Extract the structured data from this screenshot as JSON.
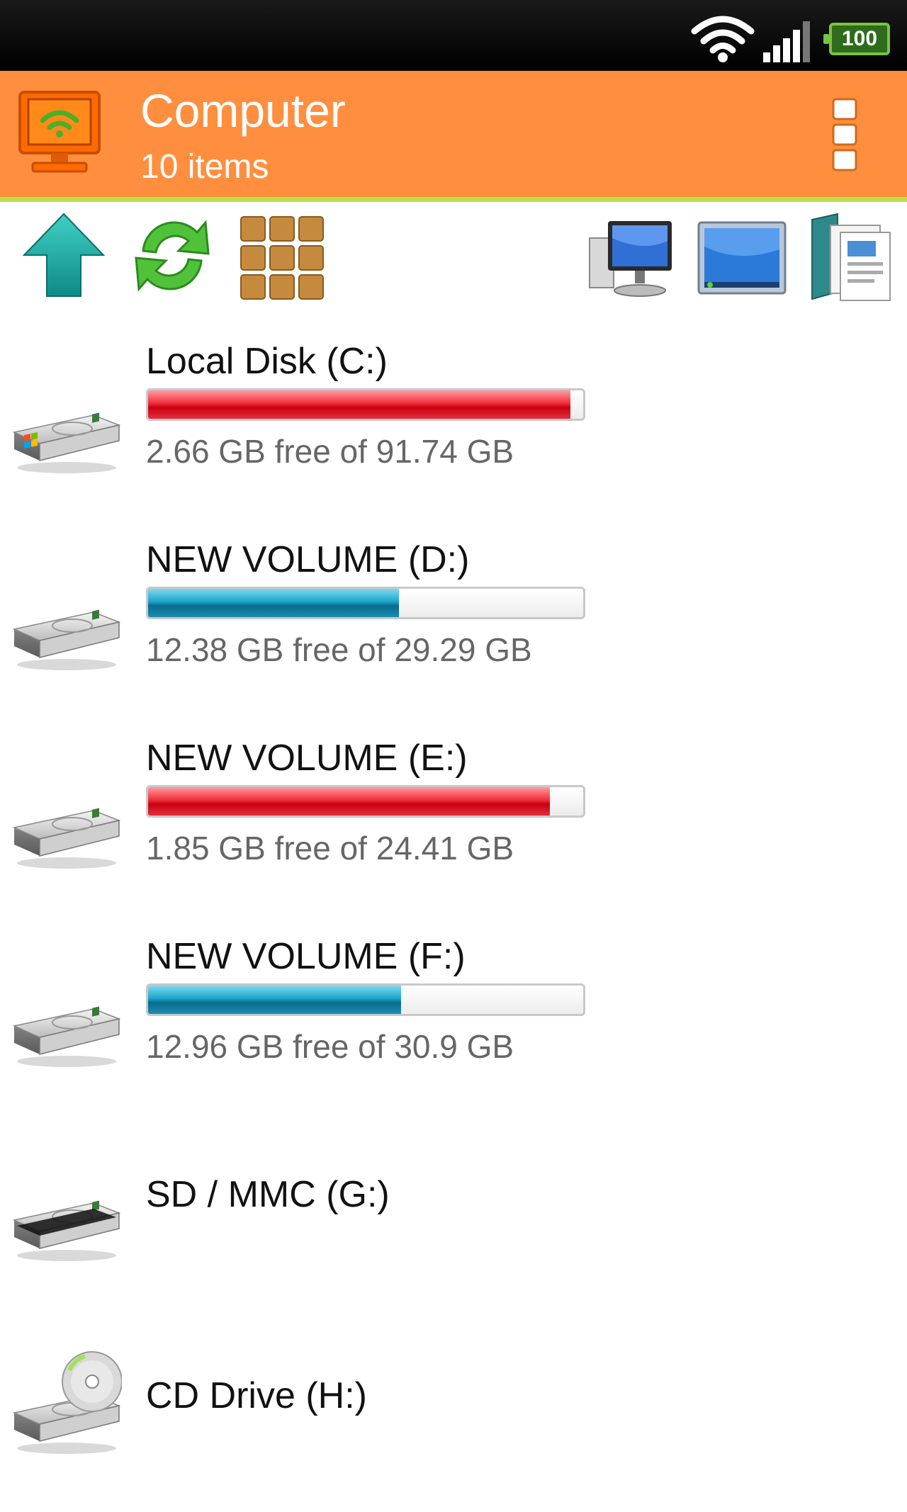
{
  "status_bar": {
    "battery": "100"
  },
  "action_bar": {
    "title": "Computer",
    "subtitle": "10 items"
  },
  "toolbar": {
    "left": [
      "up-arrow-icon",
      "refresh-icon",
      "grid-view-icon"
    ],
    "right": [
      "computer-icon",
      "desktop-icon",
      "documents-icon"
    ]
  },
  "drives": [
    {
      "name": "Local Disk (C:)",
      "free": "2.66 GB free of 91.74 GB",
      "used_fraction": 0.971,
      "bar_color": "red",
      "icon": "windows-hard-drive-icon"
    },
    {
      "name": "NEW VOLUME (D:)",
      "free": "12.38 GB free of 29.29 GB",
      "used_fraction": 0.577,
      "bar_color": "blue",
      "icon": "hard-drive-icon"
    },
    {
      "name": "NEW VOLUME (E:)",
      "free": "1.85 GB free of 24.41 GB",
      "used_fraction": 0.924,
      "bar_color": "red",
      "icon": "hard-drive-icon"
    },
    {
      "name": "NEW VOLUME (F:)",
      "free": "12.96 GB free of 30.9 GB",
      "used_fraction": 0.581,
      "bar_color": "blue",
      "icon": "hard-drive-icon"
    },
    {
      "name": "SD / MMC (G:)",
      "icon": "sd-card-drive-icon"
    },
    {
      "name": "CD Drive (H:)",
      "icon": "cd-drive-icon"
    }
  ],
  "colors": {
    "action_bar": "#ff8f3f",
    "action_bar_underline": "#b8e04a",
    "usage_high": "#e0101e",
    "usage_normal": "#1aa0c8"
  }
}
